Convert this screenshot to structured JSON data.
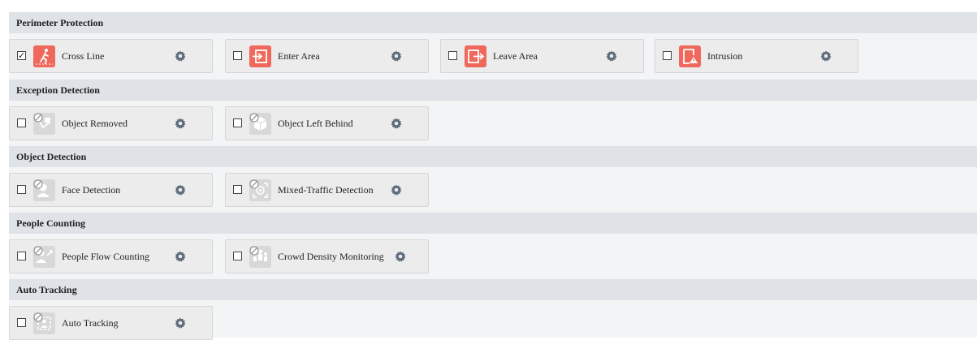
{
  "sections": [
    {
      "title": "Perimeter Protection",
      "items": [
        {
          "label": "Cross Line",
          "checked": true,
          "icon": "cross-line-icon",
          "enabled": true
        },
        {
          "label": "Enter Area",
          "checked": false,
          "icon": "enter-area-icon",
          "enabled": true
        },
        {
          "label": "Leave Area",
          "checked": false,
          "icon": "leave-area-icon",
          "enabled": true
        },
        {
          "label": "Intrusion",
          "checked": false,
          "icon": "intrusion-icon",
          "enabled": true
        }
      ]
    },
    {
      "title": "Exception Detection",
      "items": [
        {
          "label": "Object Removed",
          "checked": false,
          "icon": "object-removed-icon",
          "enabled": false
        },
        {
          "label": "Object Left Behind",
          "checked": false,
          "icon": "object-left-behind-icon",
          "enabled": false
        }
      ]
    },
    {
      "title": "Object Detection",
      "items": [
        {
          "label": "Face Detection",
          "checked": false,
          "icon": "face-detection-icon",
          "enabled": false
        },
        {
          "label": "Mixed-Traffic Detection",
          "checked": false,
          "icon": "mixed-traffic-icon",
          "enabled": false
        }
      ]
    },
    {
      "title": "People Counting",
      "items": [
        {
          "label": "People Flow Counting",
          "checked": false,
          "icon": "people-flow-icon",
          "enabled": false
        },
        {
          "label": "Crowd Density Monitoring",
          "checked": false,
          "icon": "crowd-density-icon",
          "enabled": false
        }
      ]
    },
    {
      "title": "Auto Tracking",
      "items": [
        {
          "label": "Auto Tracking",
          "checked": false,
          "icon": "auto-tracking-icon",
          "enabled": false
        }
      ]
    }
  ],
  "colors": {
    "accent_red": "#f0685b",
    "disabled_gray": "#d8d8d8",
    "header_bg": "#dfe2e7",
    "body_bg": "#f3f4f6"
  }
}
